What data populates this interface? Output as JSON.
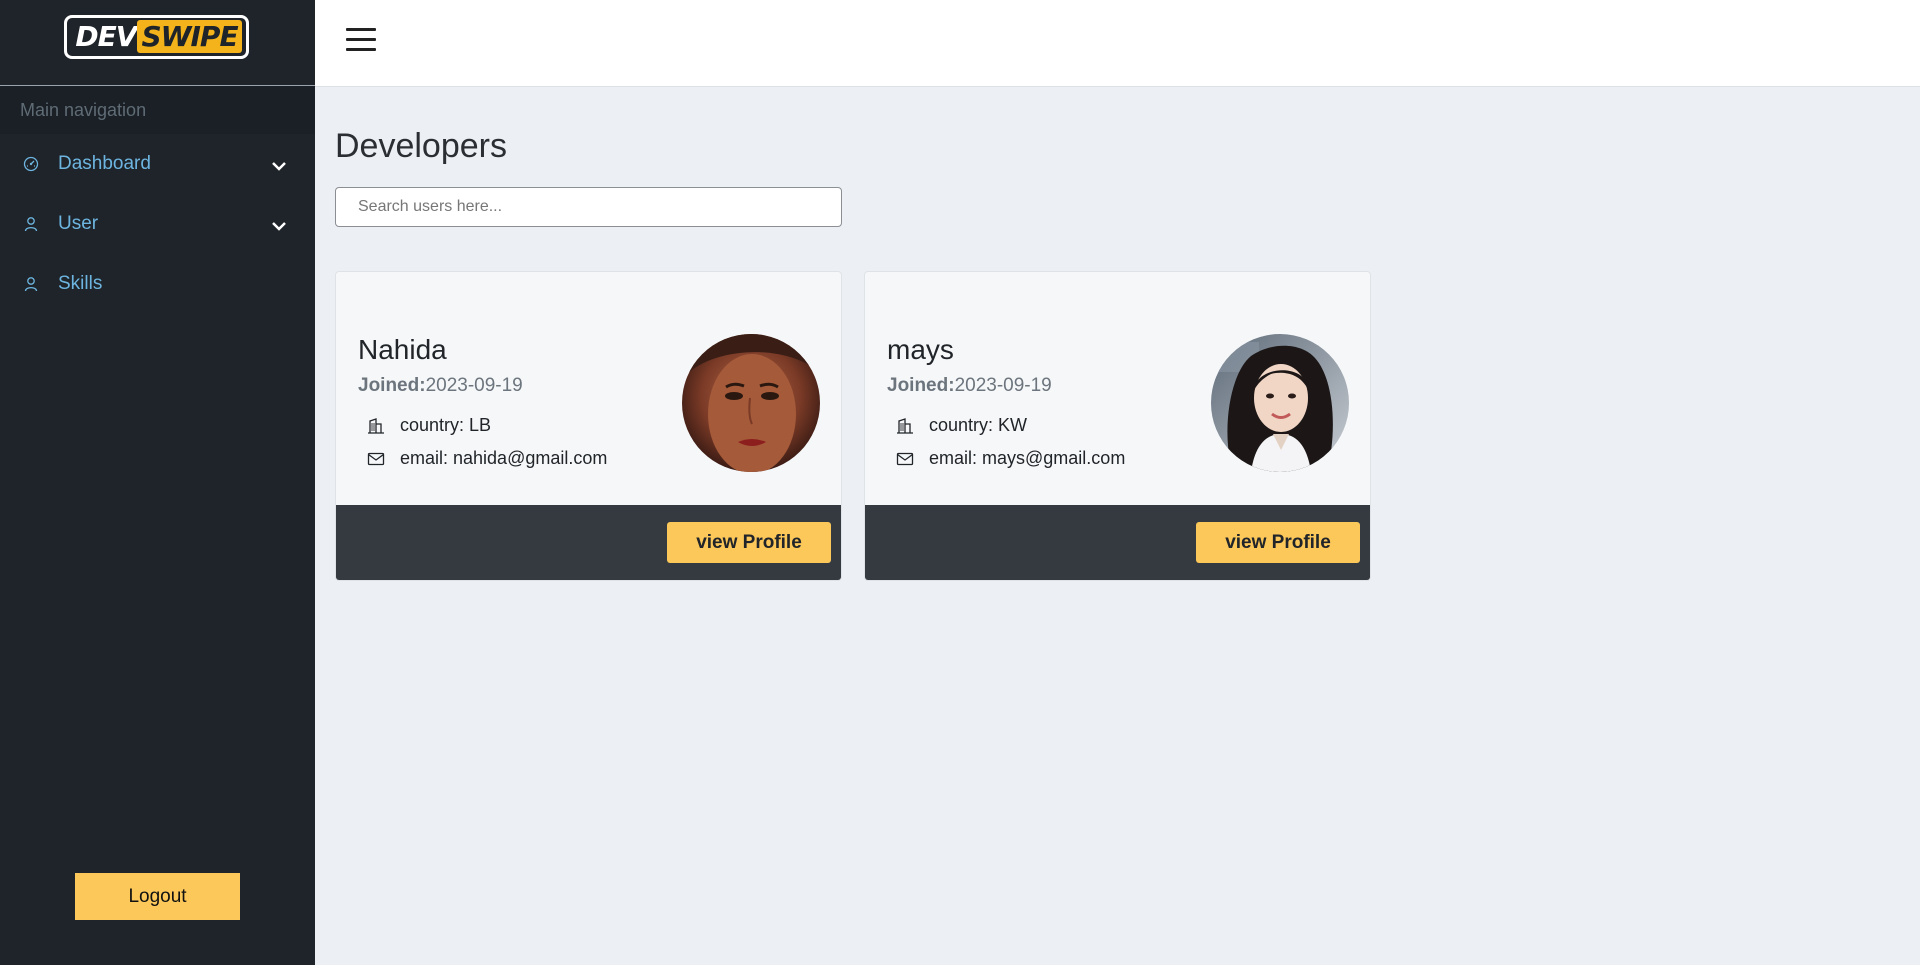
{
  "sidebar": {
    "logo": {
      "part1": "DEV",
      "part2": "SWIPE"
    },
    "nav_header": "Main navigation",
    "items": [
      {
        "label": "Dashboard",
        "icon": "gauge-icon",
        "has_dropdown": true
      },
      {
        "label": "User",
        "icon": "user-icon",
        "has_dropdown": true
      },
      {
        "label": "Skills",
        "icon": "user-icon",
        "has_dropdown": false
      }
    ],
    "logout_label": "Logout"
  },
  "topbar": {
    "menu_icon": "hamburger-icon"
  },
  "main": {
    "title": "Developers",
    "search": {
      "placeholder": "Search users here...",
      "value": ""
    },
    "cards": [
      {
        "name": "Nahida",
        "joined_label": "Joined:",
        "joined_date": "2023-09-19",
        "country": "country: LB",
        "email": "email: nahida@gmail.com",
        "button_label": "view Profile"
      },
      {
        "name": "mays",
        "joined_label": "Joined:",
        "joined_date": "2023-09-19",
        "country": "country: KW",
        "email": "email: mays@gmail.com",
        "button_label": "view Profile"
      }
    ]
  },
  "colors": {
    "sidebar_bg": "#1e2429",
    "accent": "#fcc85a",
    "link": "#6db5e0",
    "main_bg": "#eceff3",
    "card_footer": "#343a40"
  }
}
